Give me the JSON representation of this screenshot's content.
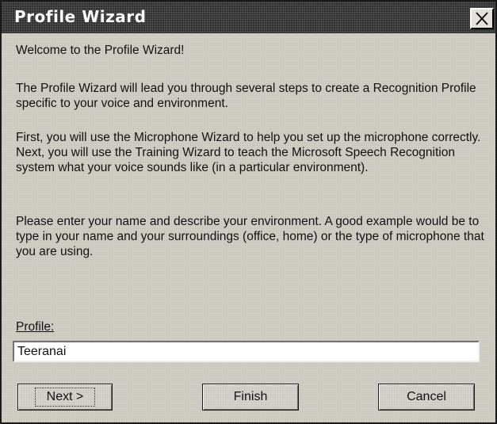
{
  "window": {
    "title": "Profile Wizard"
  },
  "content": {
    "welcome": "Welcome to the Profile Wizard!",
    "para1": "The Profile Wizard will lead you through several steps to create a Recognition Profile specific to your voice and environment.",
    "para2": "First, you will use the Microphone Wizard to help you set up the microphone correctly.  Next, you will use the Training Wizard to teach the Microsoft Speech Recognition system what your voice sounds like (in a particular environment).",
    "para3": "Please enter your name and describe your environment.  A good example would be to type in your name and your surroundings (office, home) or the type of microphone that you are using."
  },
  "profile": {
    "label": "Profile:",
    "value": "Teeranai"
  },
  "buttons": {
    "next": "Next >",
    "finish": "Finish",
    "cancel": "Cancel"
  },
  "icons": {
    "close": "close-icon"
  }
}
